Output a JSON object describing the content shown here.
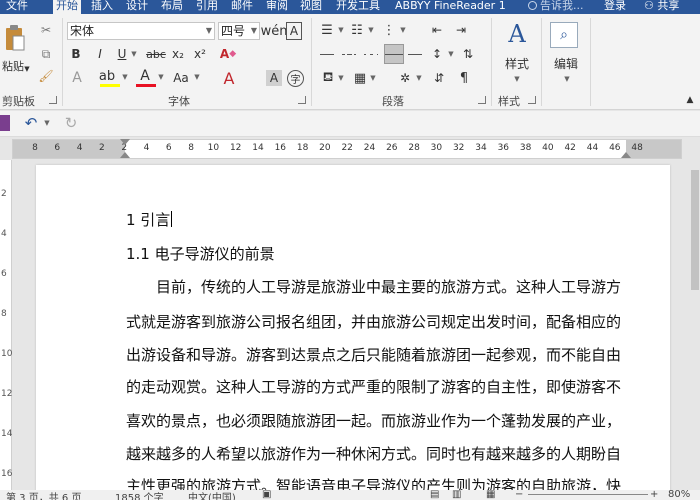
{
  "tabs": [
    "文件",
    "开始",
    "插入",
    "设计",
    "布局",
    "引用",
    "邮件",
    "审阅",
    "视图",
    "开发工具",
    "ABBYY FineReader 1"
  ],
  "tell_me": "告诉我...",
  "login": "登录",
  "share": "共享",
  "clipboard": {
    "paste_label": "粘贴",
    "group_label": "剪贴板"
  },
  "font": {
    "name": "宋体",
    "size": "四号",
    "bold": "B",
    "italic": "I",
    "underline": "U",
    "strike": "abc",
    "subscript": "x₂",
    "superscript": "x²",
    "clear_format": "A",
    "grow_font": "A",
    "shrink_font": "A",
    "font_color_letter": "A",
    "change_case": "Aa",
    "char_shading": "A",
    "enclose": "字",
    "pinyin": "A",
    "group_label": "字体"
  },
  "paragraph": {
    "group_label": "段落"
  },
  "styles": {
    "label": "样式",
    "group_label": "样式"
  },
  "editing": {
    "label": "编辑"
  },
  "ruler": {
    "numbers": [
      "8",
      "6",
      "4",
      "2",
      "2",
      "4",
      "6",
      "8",
      "10",
      "12",
      "14",
      "16",
      "18",
      "20",
      "22",
      "24",
      "26",
      "28",
      "30",
      "32",
      "34",
      "36",
      "38",
      "40",
      "42",
      "44",
      "46",
      "48"
    ]
  },
  "vruler_numbers": [
    "2",
    "4",
    "6",
    "8",
    "10",
    "12",
    "14",
    "16"
  ],
  "document": {
    "heading1": "1  引言",
    "heading2": "1.1  电子导游仪的前景",
    "lines": [
      "目前，传统的人工导游是旅游业中最主要的旅游方式。这种人工导游方",
      "式就是游客到旅游公司报名组团，并由旅游公司规定出发时间，配备相应的",
      "出游设备和导游。游客到达景点之后只能随着旅游团一起参观，而不能自由",
      "的走动观赏。这种人工导游的方式严重的限制了游客的自主性，即使游客不",
      "喜欢的景点，也必须跟随旅游团一起。而旅游业作为一个蓬勃发展的产业，",
      "越来越多的人希望以旅游作为一种休闲方式。同时也有越来越多的人期盼自",
      "主性更强的旅游方式。智能语音电子导游仪的产生则为游客的自助旅游，快"
    ]
  },
  "status": {
    "page": "第 3 页，共 6 页",
    "words": "1858 个字",
    "language": "中文(中国)",
    "zoom": "80%"
  },
  "colors": {
    "accent": "#2b579a",
    "highlight": "#ffff00",
    "font_color": "#e81123"
  }
}
